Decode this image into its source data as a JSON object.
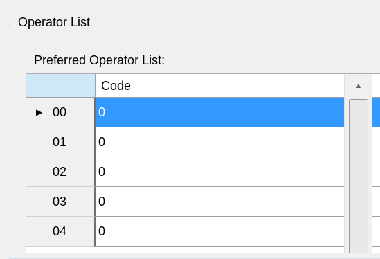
{
  "groupbox": {
    "title": "Operator List"
  },
  "grid": {
    "label": "Preferred Operator List:",
    "column_header": "Code",
    "current_row_indicator": "▶",
    "rows": [
      {
        "label": "00",
        "code": "0"
      },
      {
        "label": "01",
        "code": "0"
      },
      {
        "label": "02",
        "code": "0"
      },
      {
        "label": "03",
        "code": "0"
      },
      {
        "label": "04",
        "code": "0"
      }
    ],
    "selection_color": "#3399ff"
  },
  "scrollbar": {
    "up_arrow": "▲"
  }
}
